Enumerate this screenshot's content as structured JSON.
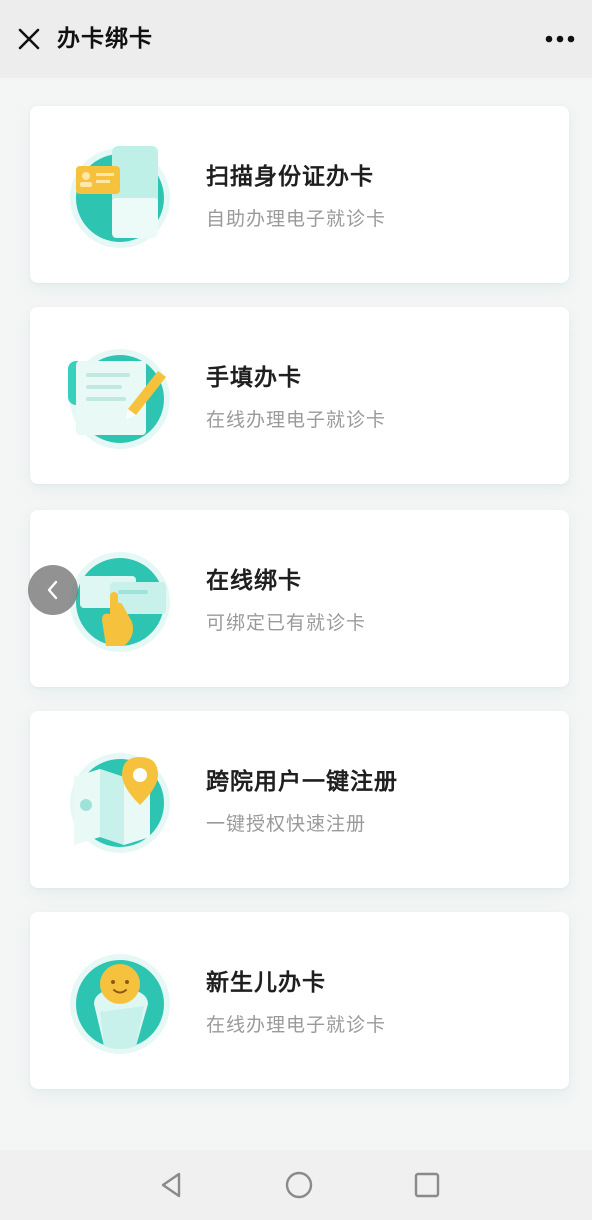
{
  "header": {
    "title": "办卡绑卡",
    "close_icon": "close-icon",
    "more_icon": "more-dots-icon"
  },
  "cards": [
    {
      "title": "扫描身份证办卡",
      "subtitle": "自助办理电子就诊卡",
      "icon": "id-card-scan-icon"
    },
    {
      "title": "手填办卡",
      "subtitle": "在线办理电子就诊卡",
      "icon": "form-pencil-icon"
    },
    {
      "title": "在线绑卡",
      "subtitle": "可绑定已有就诊卡",
      "icon": "card-bind-hand-icon"
    },
    {
      "title": "跨院用户一键注册",
      "subtitle": "一键授权快速注册",
      "icon": "map-pin-icon"
    },
    {
      "title": "新生儿办卡",
      "subtitle": "在线办理电子就诊卡",
      "icon": "baby-icon"
    }
  ],
  "floating_back_icon": "chevron-left-icon",
  "system_nav": [
    "back-triangle-icon",
    "home-circle-icon",
    "recents-square-icon"
  ],
  "colors": {
    "accent_teal": "#2ec4b2",
    "accent_light": "#bff0e8",
    "accent_orange": "#f6c23e"
  }
}
